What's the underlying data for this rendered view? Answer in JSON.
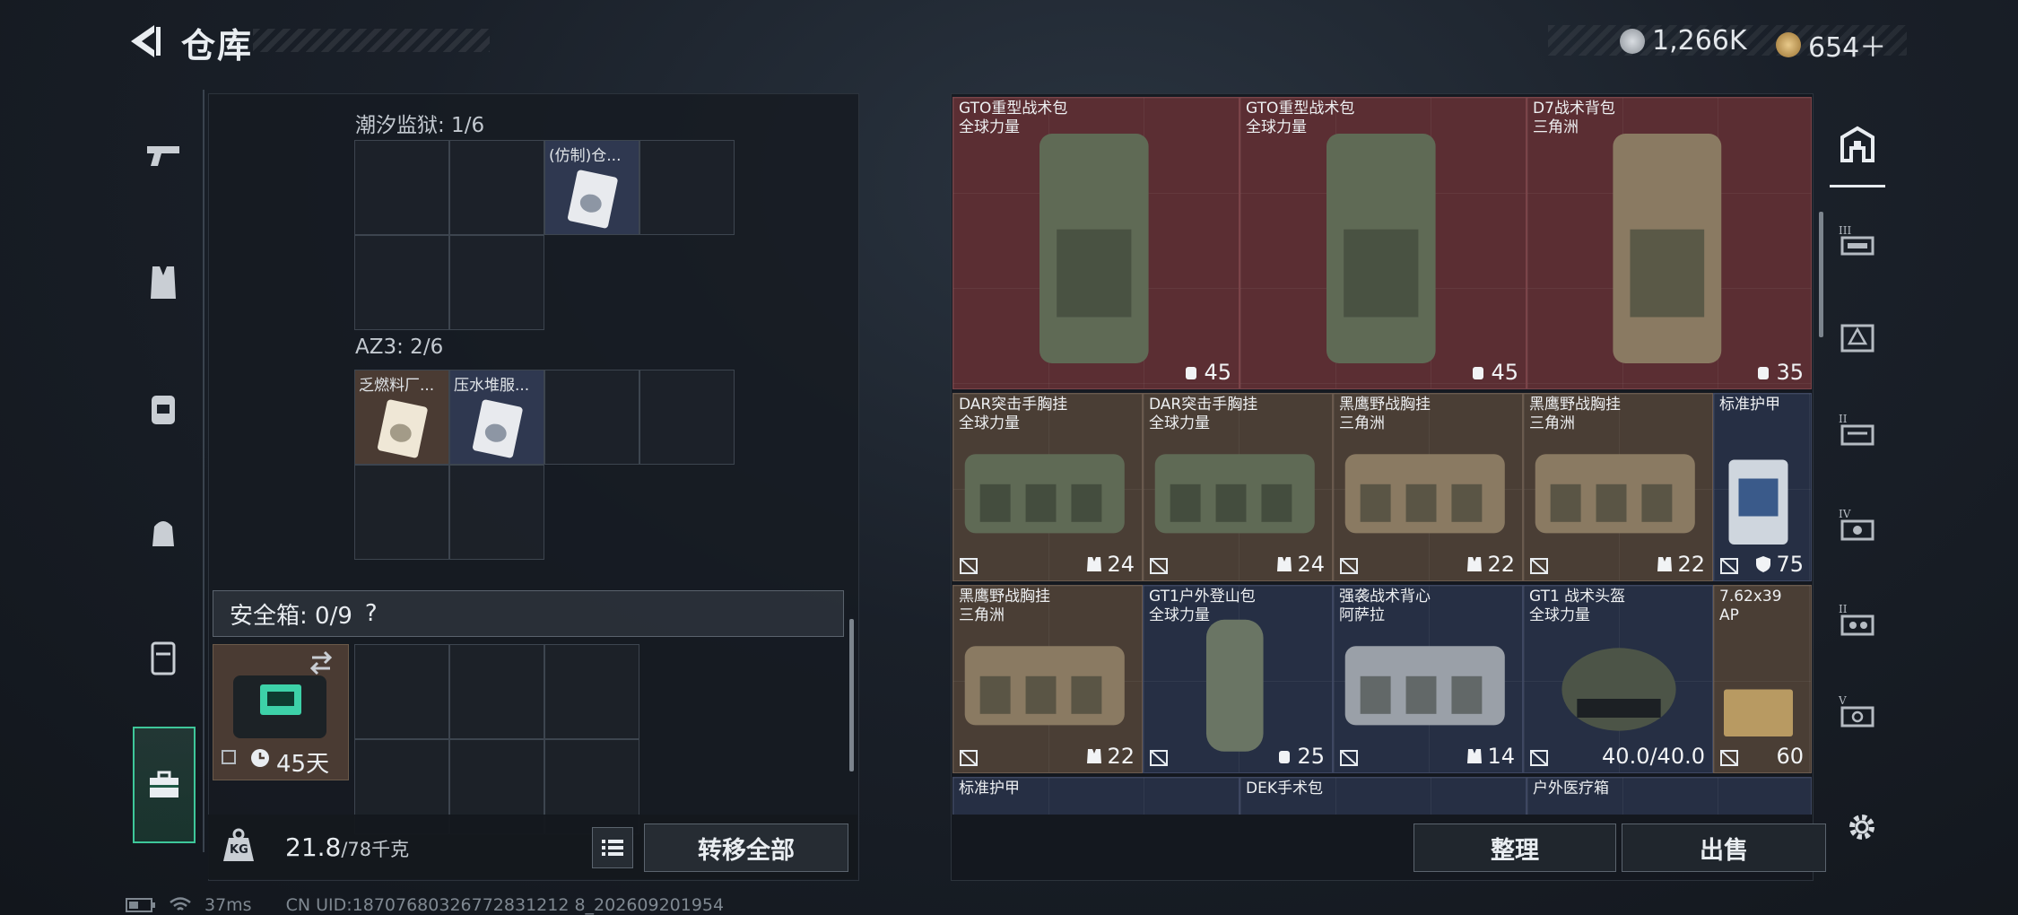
{
  "header": {
    "title": "仓库",
    "currency": [
      {
        "icon": "silver-coin-icon",
        "value": "1,266K"
      },
      {
        "icon": "gold-coin-icon",
        "value": "654＋"
      }
    ]
  },
  "left_nav": [
    {
      "icon": "pistol-icon"
    },
    {
      "icon": "vest-icon"
    },
    {
      "icon": "backpack-icon"
    },
    {
      "icon": "pouch-icon"
    },
    {
      "icon": "container-icon"
    },
    {
      "icon": "toolbox-icon",
      "active": true
    }
  ],
  "sections": {
    "prison": {
      "label": "潮汐监狱: 1/6",
      "items": [
        {
          "label": "(仿制)仓..."
        }
      ]
    },
    "az3": {
      "label": "AZ3: 2/6",
      "items": [
        {
          "label": "乏燃料厂..."
        },
        {
          "label": "压水堆服..."
        }
      ]
    }
  },
  "safebox": {
    "title": "安全箱: 0/9",
    "help": "?",
    "timer": "45天"
  },
  "bottom_left": {
    "weight_icon_text": "KG",
    "weight_value": "21.8",
    "weight_capacity": "/78千克",
    "transfer_all": "转移全部"
  },
  "stash": {
    "tiles": [
      {
        "name": "GTO重型战术包",
        "sub": "全球力量",
        "count": "45",
        "count_icon": "backpack-small-icon",
        "color": "red"
      },
      {
        "name": "GTO重型战术包",
        "sub": "全球力量",
        "count": "45",
        "count_icon": "backpack-small-icon",
        "color": "red"
      },
      {
        "name": "D7战术背包",
        "sub": "三角洲",
        "count": "35",
        "count_icon": "backpack-small-icon",
        "color": "red"
      },
      {
        "name": "DAR突击手胸挂",
        "sub": "全球力量",
        "count": "24",
        "count_icon": "vest-small-icon",
        "color": "brown"
      },
      {
        "name": "DAR突击手胸挂",
        "sub": "全球力量",
        "count": "24",
        "count_icon": "vest-small-icon",
        "color": "brown"
      },
      {
        "name": "黑鹰野战胸挂",
        "sub": "三角洲",
        "count": "22",
        "count_icon": "vest-small-icon",
        "color": "brown"
      },
      {
        "name": "黑鹰野战胸挂",
        "sub": "三角洲",
        "count": "22",
        "count_icon": "vest-small-icon",
        "color": "brown"
      },
      {
        "name": "标准护甲",
        "sub": "",
        "count": "75",
        "count_icon": "shield-icon",
        "color": "navy"
      },
      {
        "name": "黑鹰野战胸挂",
        "sub": "三角洲",
        "count": "22",
        "count_icon": "vest-small-icon",
        "color": "brown"
      },
      {
        "name": "GT1户外登山包",
        "sub": "全球力量",
        "count": "25",
        "count_icon": "backpack-small-icon",
        "color": "navy"
      },
      {
        "name": "强袭战术背心",
        "sub": "阿萨拉",
        "count": "14",
        "count_icon": "vest-small-icon",
        "color": "navy"
      },
      {
        "name": "GT1 战术头盔",
        "sub": "全球力量",
        "count": "40.0/40.0",
        "count_icon": "",
        "color": "navy"
      },
      {
        "name": "7.62x39",
        "sub": "AP",
        "count": "60",
        "count_icon": "",
        "color": "brown"
      },
      {
        "name": "标准护甲",
        "sub": "",
        "count": "",
        "count_icon": "",
        "color": "navy"
      },
      {
        "name": "DEK手术包",
        "sub": "",
        "count": "",
        "count_icon": "",
        "color": "navy"
      },
      {
        "name": "户外医疗箱",
        "sub": "",
        "count": "",
        "count_icon": "",
        "color": "navy"
      }
    ],
    "sort": "整理",
    "sell": "出售"
  },
  "right_nav": [
    {
      "icon": "storage-home-icon",
      "active": true
    },
    {
      "icon": "shelf-3-icon"
    },
    {
      "icon": "shelf-warning-icon"
    },
    {
      "icon": "shelf-2-icon"
    },
    {
      "icon": "shelf-4-icon"
    },
    {
      "icon": "shelf-2b-icon"
    },
    {
      "icon": "shelf-5-icon"
    }
  ],
  "status": {
    "ping": "37ms",
    "uid": "CN UID:18707680326772831212 8_202609201954"
  },
  "colors": {
    "accent_green": "#3ec79a",
    "tile_red": "#5b2e33",
    "tile_brown": "#4a3e35",
    "tile_navy": "#262f44"
  }
}
